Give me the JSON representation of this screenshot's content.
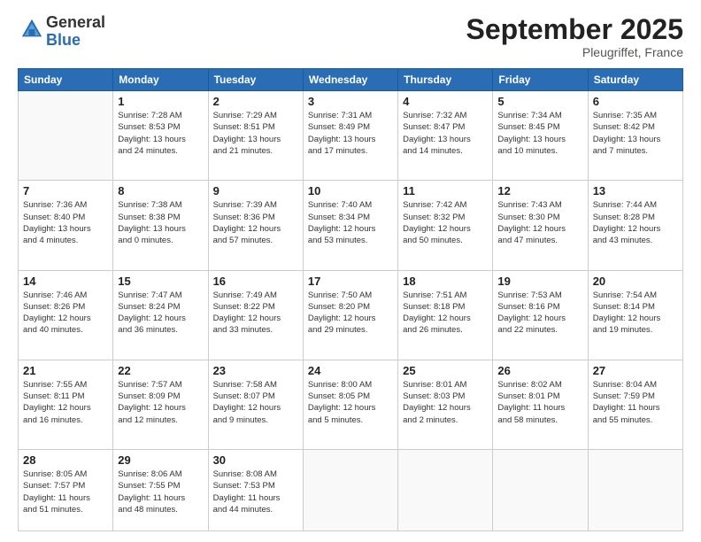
{
  "header": {
    "logo_general": "General",
    "logo_blue": "Blue",
    "month": "September 2025",
    "location": "Pleugriffet, France"
  },
  "days_of_week": [
    "Sunday",
    "Monday",
    "Tuesday",
    "Wednesday",
    "Thursday",
    "Friday",
    "Saturday"
  ],
  "weeks": [
    [
      {
        "day": "",
        "info": ""
      },
      {
        "day": "1",
        "info": "Sunrise: 7:28 AM\nSunset: 8:53 PM\nDaylight: 13 hours\nand 24 minutes."
      },
      {
        "day": "2",
        "info": "Sunrise: 7:29 AM\nSunset: 8:51 PM\nDaylight: 13 hours\nand 21 minutes."
      },
      {
        "day": "3",
        "info": "Sunrise: 7:31 AM\nSunset: 8:49 PM\nDaylight: 13 hours\nand 17 minutes."
      },
      {
        "day": "4",
        "info": "Sunrise: 7:32 AM\nSunset: 8:47 PM\nDaylight: 13 hours\nand 14 minutes."
      },
      {
        "day": "5",
        "info": "Sunrise: 7:34 AM\nSunset: 8:45 PM\nDaylight: 13 hours\nand 10 minutes."
      },
      {
        "day": "6",
        "info": "Sunrise: 7:35 AM\nSunset: 8:42 PM\nDaylight: 13 hours\nand 7 minutes."
      }
    ],
    [
      {
        "day": "7",
        "info": "Sunrise: 7:36 AM\nSunset: 8:40 PM\nDaylight: 13 hours\nand 4 minutes."
      },
      {
        "day": "8",
        "info": "Sunrise: 7:38 AM\nSunset: 8:38 PM\nDaylight: 13 hours\nand 0 minutes."
      },
      {
        "day": "9",
        "info": "Sunrise: 7:39 AM\nSunset: 8:36 PM\nDaylight: 12 hours\nand 57 minutes."
      },
      {
        "day": "10",
        "info": "Sunrise: 7:40 AM\nSunset: 8:34 PM\nDaylight: 12 hours\nand 53 minutes."
      },
      {
        "day": "11",
        "info": "Sunrise: 7:42 AM\nSunset: 8:32 PM\nDaylight: 12 hours\nand 50 minutes."
      },
      {
        "day": "12",
        "info": "Sunrise: 7:43 AM\nSunset: 8:30 PM\nDaylight: 12 hours\nand 47 minutes."
      },
      {
        "day": "13",
        "info": "Sunrise: 7:44 AM\nSunset: 8:28 PM\nDaylight: 12 hours\nand 43 minutes."
      }
    ],
    [
      {
        "day": "14",
        "info": "Sunrise: 7:46 AM\nSunset: 8:26 PM\nDaylight: 12 hours\nand 40 minutes."
      },
      {
        "day": "15",
        "info": "Sunrise: 7:47 AM\nSunset: 8:24 PM\nDaylight: 12 hours\nand 36 minutes."
      },
      {
        "day": "16",
        "info": "Sunrise: 7:49 AM\nSunset: 8:22 PM\nDaylight: 12 hours\nand 33 minutes."
      },
      {
        "day": "17",
        "info": "Sunrise: 7:50 AM\nSunset: 8:20 PM\nDaylight: 12 hours\nand 29 minutes."
      },
      {
        "day": "18",
        "info": "Sunrise: 7:51 AM\nSunset: 8:18 PM\nDaylight: 12 hours\nand 26 minutes."
      },
      {
        "day": "19",
        "info": "Sunrise: 7:53 AM\nSunset: 8:16 PM\nDaylight: 12 hours\nand 22 minutes."
      },
      {
        "day": "20",
        "info": "Sunrise: 7:54 AM\nSunset: 8:14 PM\nDaylight: 12 hours\nand 19 minutes."
      }
    ],
    [
      {
        "day": "21",
        "info": "Sunrise: 7:55 AM\nSunset: 8:11 PM\nDaylight: 12 hours\nand 16 minutes."
      },
      {
        "day": "22",
        "info": "Sunrise: 7:57 AM\nSunset: 8:09 PM\nDaylight: 12 hours\nand 12 minutes."
      },
      {
        "day": "23",
        "info": "Sunrise: 7:58 AM\nSunset: 8:07 PM\nDaylight: 12 hours\nand 9 minutes."
      },
      {
        "day": "24",
        "info": "Sunrise: 8:00 AM\nSunset: 8:05 PM\nDaylight: 12 hours\nand 5 minutes."
      },
      {
        "day": "25",
        "info": "Sunrise: 8:01 AM\nSunset: 8:03 PM\nDaylight: 12 hours\nand 2 minutes."
      },
      {
        "day": "26",
        "info": "Sunrise: 8:02 AM\nSunset: 8:01 PM\nDaylight: 11 hours\nand 58 minutes."
      },
      {
        "day": "27",
        "info": "Sunrise: 8:04 AM\nSunset: 7:59 PM\nDaylight: 11 hours\nand 55 minutes."
      }
    ],
    [
      {
        "day": "28",
        "info": "Sunrise: 8:05 AM\nSunset: 7:57 PM\nDaylight: 11 hours\nand 51 minutes."
      },
      {
        "day": "29",
        "info": "Sunrise: 8:06 AM\nSunset: 7:55 PM\nDaylight: 11 hours\nand 48 minutes."
      },
      {
        "day": "30",
        "info": "Sunrise: 8:08 AM\nSunset: 7:53 PM\nDaylight: 11 hours\nand 44 minutes."
      },
      {
        "day": "",
        "info": ""
      },
      {
        "day": "",
        "info": ""
      },
      {
        "day": "",
        "info": ""
      },
      {
        "day": "",
        "info": ""
      }
    ]
  ]
}
